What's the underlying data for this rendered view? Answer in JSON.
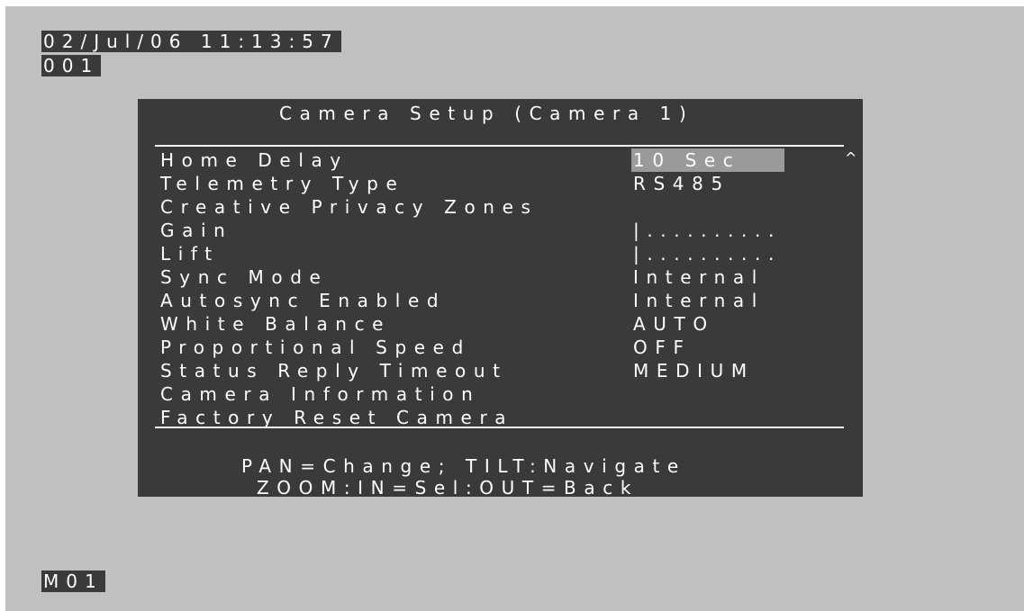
{
  "header": {
    "datetime": "02/Jul/06 11:13:57",
    "camera_number": "001"
  },
  "menu": {
    "title": "Camera Setup (Camera 1)",
    "scroll_indicator": "^",
    "items": [
      {
        "label": "Home Delay",
        "value": "10 Sec",
        "selected": true
      },
      {
        "label": "Telemetry Type",
        "value": "RS485"
      },
      {
        "label": "Creative Privacy Zones",
        "value": ""
      },
      {
        "label": "Gain",
        "value": "|.........."
      },
      {
        "label": "Lift",
        "value": "|.........."
      },
      {
        "label": "Sync Mode",
        "value": "Internal"
      },
      {
        "label": "Autosync Enabled",
        "value": "Internal"
      },
      {
        "label": "White Balance",
        "value": "AUTO"
      },
      {
        "label": "Proportional Speed",
        "value": "OFF"
      },
      {
        "label": "Status Reply Timeout",
        "value": "MEDIUM"
      },
      {
        "label": "Camera Information",
        "value": ""
      },
      {
        "label": "Factory Reset Camera",
        "value": ""
      }
    ],
    "help_line_1": "PAN=Change; TILT:Navigate",
    "help_line_2": "ZOOM:IN=Sel:OUT=Back"
  },
  "footer": {
    "monitor_id": "M01"
  },
  "colors": {
    "screen_background": "#c0c0c0",
    "osd_background": "#3a3a3a",
    "osd_text": "#ffffff",
    "selection_highlight": "#9a9a9a"
  }
}
